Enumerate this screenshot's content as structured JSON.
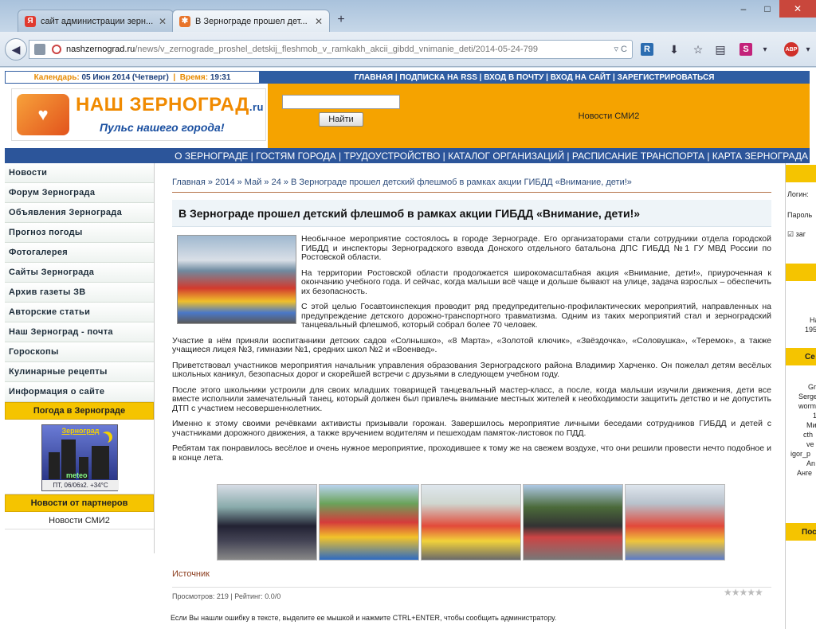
{
  "browser": {
    "tabs": [
      {
        "label": "сайт администрации зерн...",
        "favicon": "Я",
        "favicon_color": "#e03a2f",
        "active": false
      },
      {
        "label": "В Зернограде прошел дет...",
        "favicon": "✱",
        "favicon_color": "#e8742a",
        "active": true
      }
    ],
    "new_tab": "+",
    "url_host": "nashzernograd.ru",
    "url_path": "/news/v_zernograde_proshel_detskij_fleshmob_v_ramkakh_akcii_gibdd_vnimanie_deti/2014-05-24-799",
    "url_actions": "▿ C",
    "window_controls": [
      "–",
      "□",
      "✕"
    ]
  },
  "topbar": {
    "calendar_label": "Календарь:",
    "calendar_value": "05 Июн 2014 (Четверг)",
    "sep": "|",
    "time_label": "Время:",
    "time_value": "19:31",
    "menu": "ГЛАВНАЯ | ПОДПИСКА НА RSS | ВХОД В ПОЧТУ | ВХОД НА САЙТ | ЗАРЕГИСТРИРОВАТЬСЯ"
  },
  "header": {
    "logo_name": "НАШ ЗЕРНОГРАД",
    "logo_tld": ".ru",
    "slogan": "Пульс нашего города!",
    "search_button": "Найти",
    "search_value": "",
    "news_smi2": "Новости СМИ2"
  },
  "mainnav": "О ЗЕРНОГРАДЕ | ГОСТЯМ ГОРОДА | ТРУДОУСТРОЙСТВО | КАТАЛОГ ОРГАНИЗАЦИЙ | РАСПИСАНИЕ ТРАНСПОРТА | КАРТА ЗЕРНОГРАДА",
  "sidebar": {
    "items": [
      "Новости",
      "Форум Зернограда",
      "Объявления Зернограда",
      "Прогноз погоды",
      "Фотогалерея",
      "Сайты Зернограда",
      "Архив газеты ЗВ",
      "Авторские статьи",
      "Наш Зерноград - почта",
      "Гороскопы",
      "Кулинарные рецепты",
      "Информация о сайте"
    ],
    "weather_header": "Погода в Зернограде",
    "weather_title": "Зерноград",
    "weather_brand": "meteo",
    "weather_info": "ПТ, 06/06з2. +34°C",
    "partners_header": "Новости от партнеров",
    "partners_item": "Новости СМИ2"
  },
  "content": {
    "breadcrumb": "Главная » 2014 » Май » 24 » В Зернограде прошел детский флешмоб в рамках акции ГИБДД «Внимание, дети!»",
    "title": "В Зернограде прошел детский флешмоб в рамках акции ГИБДД «Внимание, дети!»",
    "paragraphs": [
      "Необычное мероприятие состоялось в городе Зернограде. Его организаторами стали сотрудники отдела городской ГИБДД и инспекторы Зерноградского взвода Донского отдельного батальона ДПС ГИБДД №1 ГУ МВД России по Ростовской области.",
      "На территории Ростовской области продолжается широкомасштабная акция «Внимание, дети!», приуроченная к окончанию учебного года. И сейчас, когда малыши всё чаще и дольше бывают на улице, задача взрослых – обеспечить их безопасность.",
      "С этой целью Госавтоинспекция проводит ряд предупредительно-профилактических мероприятий, направленных на предупреждение детского дорожно-транспортного травматизма. Одним из таких мероприятий стал и зерноградский танцевальный флешмоб, который собрал более 70 человек.",
      "Участие в нём приняли воспитанники детских садов «Солнышко», «8 Марта», «Золотой ключик», «Звёздочка», «Соловушка», «Теремок», а также учащиеся лицея №3, гимназии №1, средних школ №2 и «Военвед».",
      "Приветствовал участников мероприятия начальник управления образования Зерноградского района Владимир Харченко. Он пожелал детям весёлых школьных каникул, безопасных дорог и скорейшей встречи с друзьями в следующем учебном году.",
      "После этого школьники устроили для своих младших товарищей танцевальный мастер-класс, а после, когда малыши изучили движения, дети все вместе исполнили замечательный танец, который должен был привлечь внимание местных жителей к необходимости защитить детство и не допустить ДТП с участием несовершеннолетних.",
      "Именно к этому своими речёвками активисты призывали горожан. Завершилось мероприятие личными беседами сотрудников ГИБДД и детей с участниками дорожного движения, а также вручением водителям и пешеходам памяток-листовок по ПДД.",
      "Ребятам так понравилось весёлое и очень нужное мероприятие, проходившее к тому же на свежем воздухе, что они решили провести нечто подобное и в конце лета."
    ],
    "source": "Источник",
    "stats": "Просмотров: 219 | Рейтинг: 0.0/0",
    "rating_stars": "★★★★★",
    "error_note": "Если Вы нашли ошибку в тексте, выделите ее мышкой и нажмите CTRL+ENTER, чтобы сообщить администратору."
  },
  "rightcol": {
    "login_label": "Логин:",
    "password_label": "Пароль",
    "remember": "заг",
    "texts_mid": [
      "На",
      "195"
    ],
    "section_hdr": "Се",
    "users": [
      "Gr",
      "Serge",
      "worm",
      "1",
      "Ми",
      "cth",
      "ve",
      "igor_p",
      "An",
      "Анге"
    ],
    "bottom_hdr": "Пос"
  }
}
